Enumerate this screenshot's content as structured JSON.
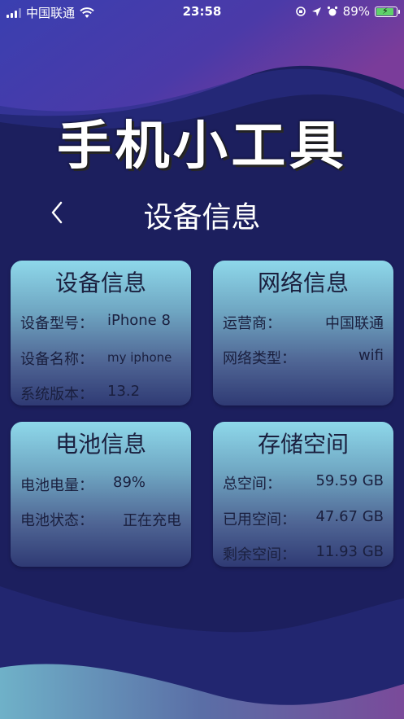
{
  "status_bar": {
    "carrier": "中国联通",
    "time": "23:58",
    "battery_percent": "89%",
    "battery_level": 0.89
  },
  "app_title": "手机小工具",
  "page_title": "设备信息",
  "back_icon": "chevron-left-icon",
  "cards": {
    "device": {
      "title": "设备信息",
      "rows": [
        {
          "key": "设备型号：",
          "value": "iPhone 8"
        },
        {
          "key": "设备名称：",
          "value": "my iphone"
        },
        {
          "key": "系统版本：",
          "value": "13.2"
        }
      ]
    },
    "network": {
      "title": "网络信息",
      "rows": [
        {
          "key": "运营商：",
          "value": "中国联通"
        },
        {
          "key": "网络类型：",
          "value": "wifi"
        }
      ]
    },
    "battery": {
      "title": "电池信息",
      "rows": [
        {
          "key": "电池电量：",
          "value": "89%"
        },
        {
          "key": "电池状态：",
          "value": "正在充电"
        }
      ]
    },
    "storage": {
      "title": "存储空间",
      "rows": [
        {
          "key": "总空间：",
          "value": "59.59 GB"
        },
        {
          "key": "已用空间：",
          "value": "47.67 GB"
        },
        {
          "key": "剩余空间：",
          "value": "11.93 GB"
        }
      ]
    }
  },
  "colors": {
    "background": "#1c1f5e",
    "card_top": "#8ed8ea",
    "card_bottom": "#2f3a74",
    "card_text": "#1a1f3e",
    "battery_fill": "#5fd16a"
  }
}
